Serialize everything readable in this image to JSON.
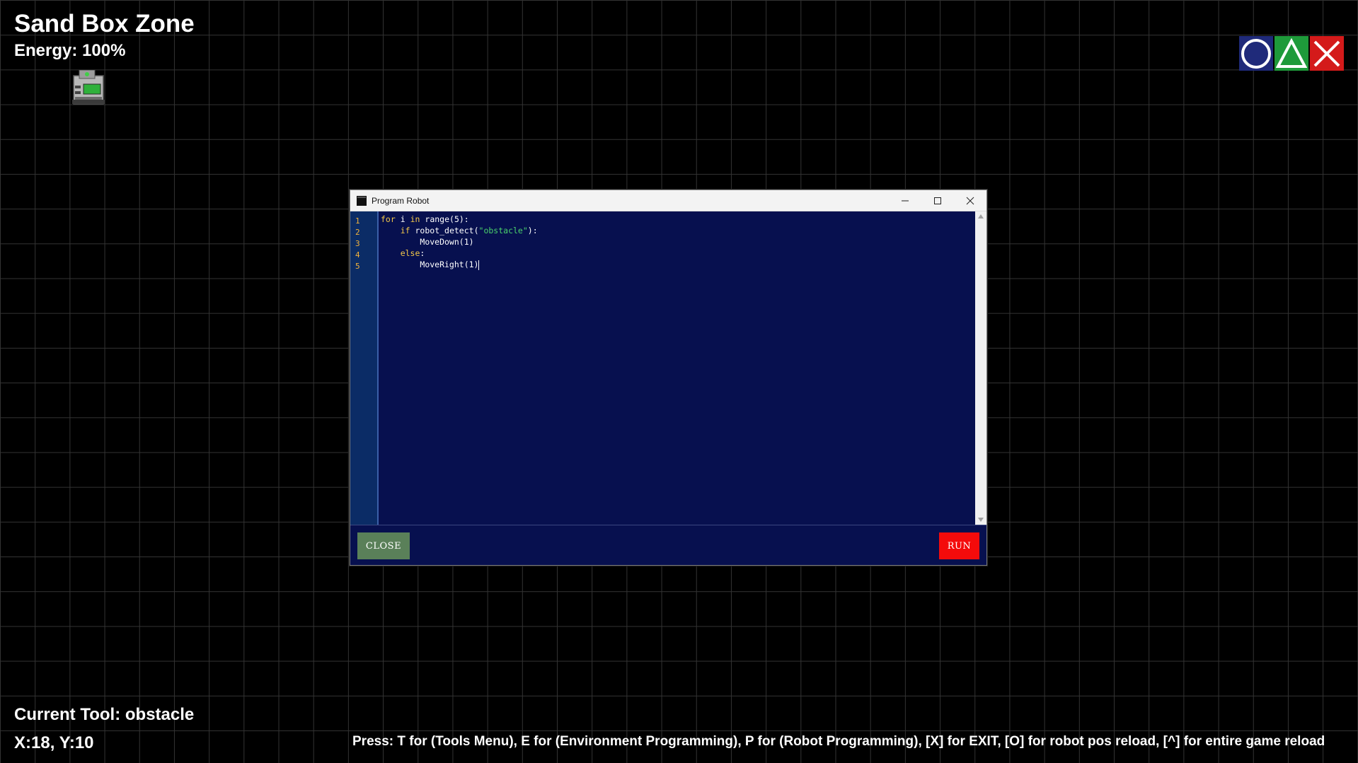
{
  "hud": {
    "title": "Sand Box Zone",
    "energy": "Energy: 100%",
    "current_tool": "Current Tool: obstacle",
    "coords": "X:18, Y:10",
    "help": "Press: T for (Tools Menu), E for (Environment Programming), P for (Robot Programming), [X] for EXIT, [O] for robot pos reload, [^] for entire game reload"
  },
  "controls": [
    {
      "name": "circle",
      "icon": "circle-icon",
      "color": "#1f2a7a"
    },
    {
      "name": "triangle",
      "icon": "triangle-icon",
      "color": "#1e9a3a"
    },
    {
      "name": "cross",
      "icon": "x-icon",
      "color": "#d41a1a"
    }
  ],
  "window": {
    "title": "Program Robot",
    "line_numbers": [
      "1",
      "2",
      "3",
      "4",
      "5"
    ],
    "code_lines": [
      "for i in range(5):",
      "    if robot_detect(\"obstacle\"):",
      "        MoveDown(1)",
      "    else:",
      "        MoveRight(1)"
    ],
    "close_label": "CLOSE",
    "run_label": "RUN"
  },
  "colors": {
    "editor_bg": "#07104f",
    "gutter_bg": "#0b2c66",
    "keyword": "#f3c84a",
    "string": "#4bd36b",
    "close_btn": "#5a8059",
    "run_btn": "#f40b0b"
  }
}
